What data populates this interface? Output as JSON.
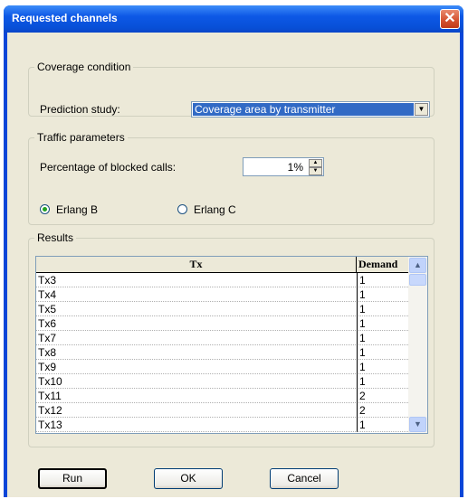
{
  "window": {
    "title": "Requested channels"
  },
  "coverage": {
    "legend": "Coverage condition",
    "label": "Prediction study:",
    "selected": "Coverage area by transmitter"
  },
  "traffic": {
    "legend": "Traffic parameters",
    "label": "Percentage of blocked calls:",
    "value": "1",
    "unit": "%",
    "radio_b": "Erlang B",
    "radio_c": "Erlang C",
    "selected_model": "Erlang B"
  },
  "results": {
    "legend": "Results",
    "columns": [
      "Tx",
      "Demand"
    ],
    "rows": [
      [
        "Tx3",
        "1"
      ],
      [
        "Tx4",
        "1"
      ],
      [
        "Tx5",
        "1"
      ],
      [
        "Tx6",
        "1"
      ],
      [
        "Tx7",
        "1"
      ],
      [
        "Tx8",
        "1"
      ],
      [
        "Tx9",
        "1"
      ],
      [
        "Tx10",
        "1"
      ],
      [
        "Tx11",
        "2"
      ],
      [
        "Tx12",
        "2"
      ],
      [
        "Tx13",
        "1"
      ]
    ]
  },
  "buttons": {
    "run": "Run",
    "ok": "OK",
    "cancel": "Cancel"
  },
  "icons": {
    "close": "close-icon",
    "dropdown": "chevron-down-icon",
    "scroll_up": "chevron-up-icon",
    "scroll_down": "chevron-down-icon"
  },
  "colors": {
    "titlebar": "#0a46d8",
    "selection": "#316ac5",
    "dialog": "#ece9d8"
  }
}
